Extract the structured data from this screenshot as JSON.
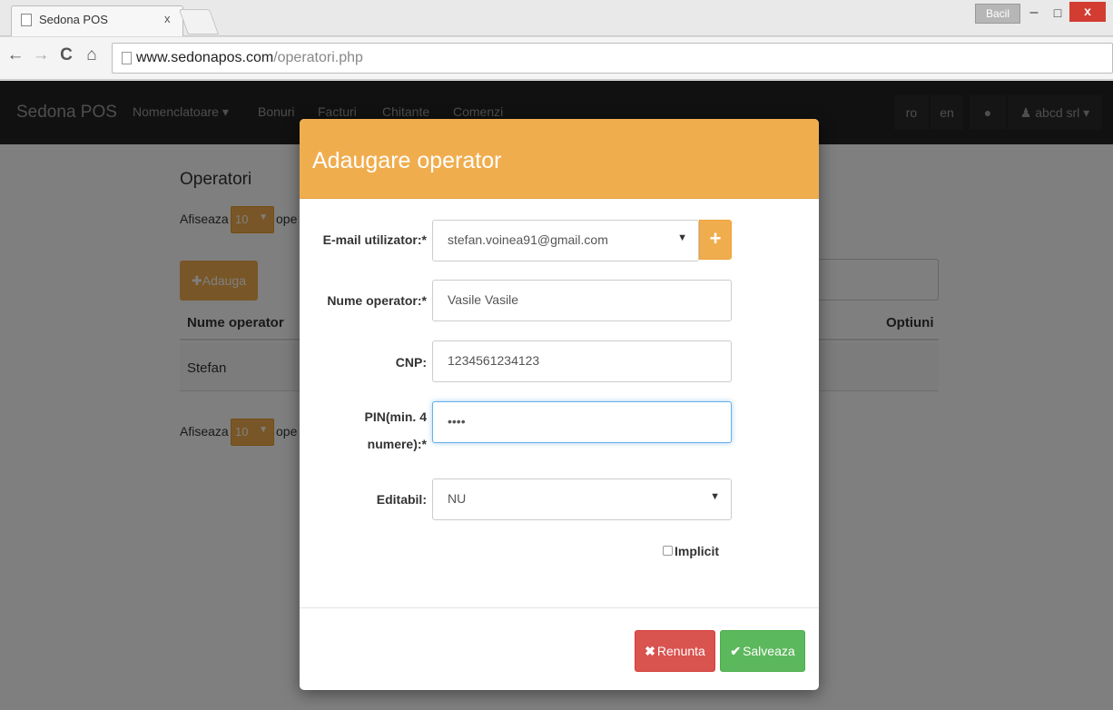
{
  "browser": {
    "tab_title": "Sedona POS",
    "tab_close": "x",
    "profile": "Bacil",
    "url_host": "www.sedonapos.com",
    "url_path": "/operatori.php"
  },
  "app": {
    "brand": "Sedona POS",
    "nav": [
      "Nomenclatoare ▾",
      "Bonuri",
      "Facturi",
      "Chitante",
      "Comenzi"
    ],
    "lang_ro": "ro",
    "lang_en": "en",
    "user": "abcd srl ▾"
  },
  "page": {
    "title": "Operatori",
    "show_label": "Afiseaza",
    "show_value": "10",
    "show_suffix": "ope",
    "add_button": "✚Adauga",
    "col_name": "Nume operator",
    "col_options": "Optiuni",
    "rows": [
      "Stefan"
    ]
  },
  "modal": {
    "title": "Adaugare operator",
    "email_label": "E-mail utilizator:*",
    "email_value": "stefan.voinea91@gmail.com",
    "name_label": "Nume operator:*",
    "name_value": "Vasile Vasile",
    "cnp_label": "CNP:",
    "cnp_value": "1234561234123",
    "pin_label_1": "PIN(min. 4",
    "pin_label_2": "numere):*",
    "pin_value": "••••",
    "editable_label": "Editabil:",
    "editable_value": "NU",
    "implicit_label": "Implicit",
    "cancel_button": "Renunta",
    "save_button": "Salveaza"
  },
  "colors": {
    "warning": "#f0ad4e",
    "danger": "#d9534f",
    "success": "#5cb85c",
    "navbar": "#222222"
  }
}
